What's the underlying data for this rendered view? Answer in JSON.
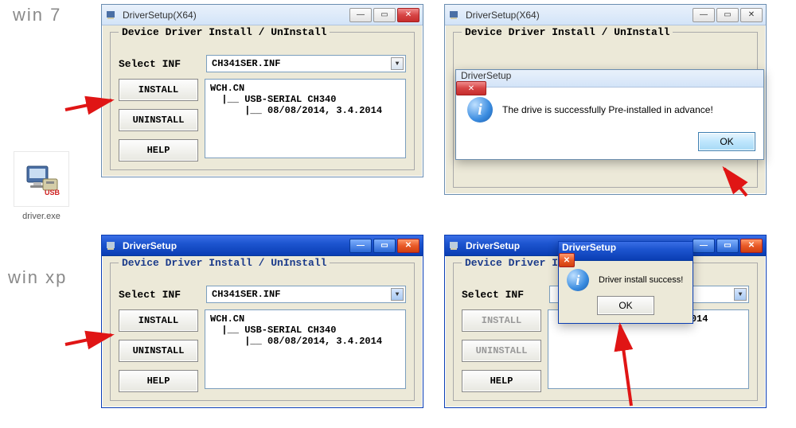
{
  "labels": {
    "win7": "win 7",
    "winxp": "win xp"
  },
  "desktop_icon": {
    "filename": "driver.exe",
    "usb_text": "USB"
  },
  "window": {
    "title_x64": "DriverSetup(X64)",
    "title_plain": "DriverSetup",
    "group_legend": "Device Driver Install / UnInstall",
    "select_inf_label": "Select INF",
    "inf_value": "CH341SER.INF",
    "btn_install": "INSTALL",
    "btn_uninstall": "UNINSTALL",
    "btn_help": "HELP",
    "info_text": "WCH.CN\n  |__ USB-SERIAL CH340\n      |__ 08/08/2014, 3.4.2014"
  },
  "dialog_win7": {
    "title": "DriverSetup",
    "message": "The drive is successfully Pre-installed in advance!",
    "ok": "OK"
  },
  "dialog_xp": {
    "title": "DriverSetup",
    "message": "Driver install success!",
    "ok": "OK"
  },
  "partial": {
    "legend_cut": "Device Driver I",
    "select_cut": "Select INF",
    "info_cut": "         /08/2014, 3.4.2014"
  }
}
